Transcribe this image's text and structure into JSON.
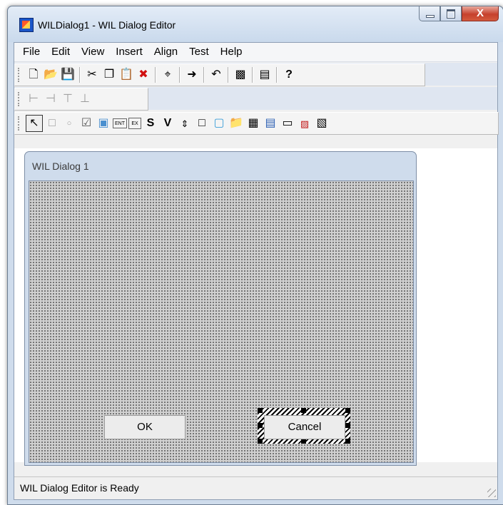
{
  "window": {
    "title": "WILDialog1 - WIL Dialog Editor",
    "close_glyph": "X"
  },
  "menu": {
    "items": [
      "File",
      "Edit",
      "View",
      "Insert",
      "Align",
      "Test",
      "Help"
    ]
  },
  "toolbar1": {
    "icons": [
      "new-file-icon",
      "open-folder-icon",
      "save-icon",
      "cut-icon",
      "copy-icon",
      "paste-icon",
      "delete-icon",
      "resize-icon",
      "forward-icon",
      "undo-icon",
      "test-run-icon",
      "properties-icon",
      "help-icon"
    ]
  },
  "toolbar2": {
    "icons": [
      "align-left-icon",
      "align-right-icon",
      "align-top-icon",
      "align-bottom-icon"
    ]
  },
  "toolbar3": {
    "icons": [
      "pointer-icon",
      "groupbox-icon",
      "radio-button-icon",
      "checkbox-icon",
      "picture-button-icon",
      "edit-box-icon",
      "multiline-edit-icon",
      "static-text-icon",
      "varytext-icon",
      "spinner-icon",
      "dropdown-icon",
      "picture-icon",
      "file-list-icon",
      "item-box-icon",
      "menu-bar-icon",
      "menu-item-icon",
      "com-control-icon",
      "report-view-icon"
    ],
    "s_label": "S",
    "v_label": "V"
  },
  "dialog": {
    "title": "WIL Dialog 1",
    "ok_label": "OK",
    "cancel_label": "Cancel"
  },
  "status": {
    "text": "WIL Dialog Editor is Ready"
  }
}
